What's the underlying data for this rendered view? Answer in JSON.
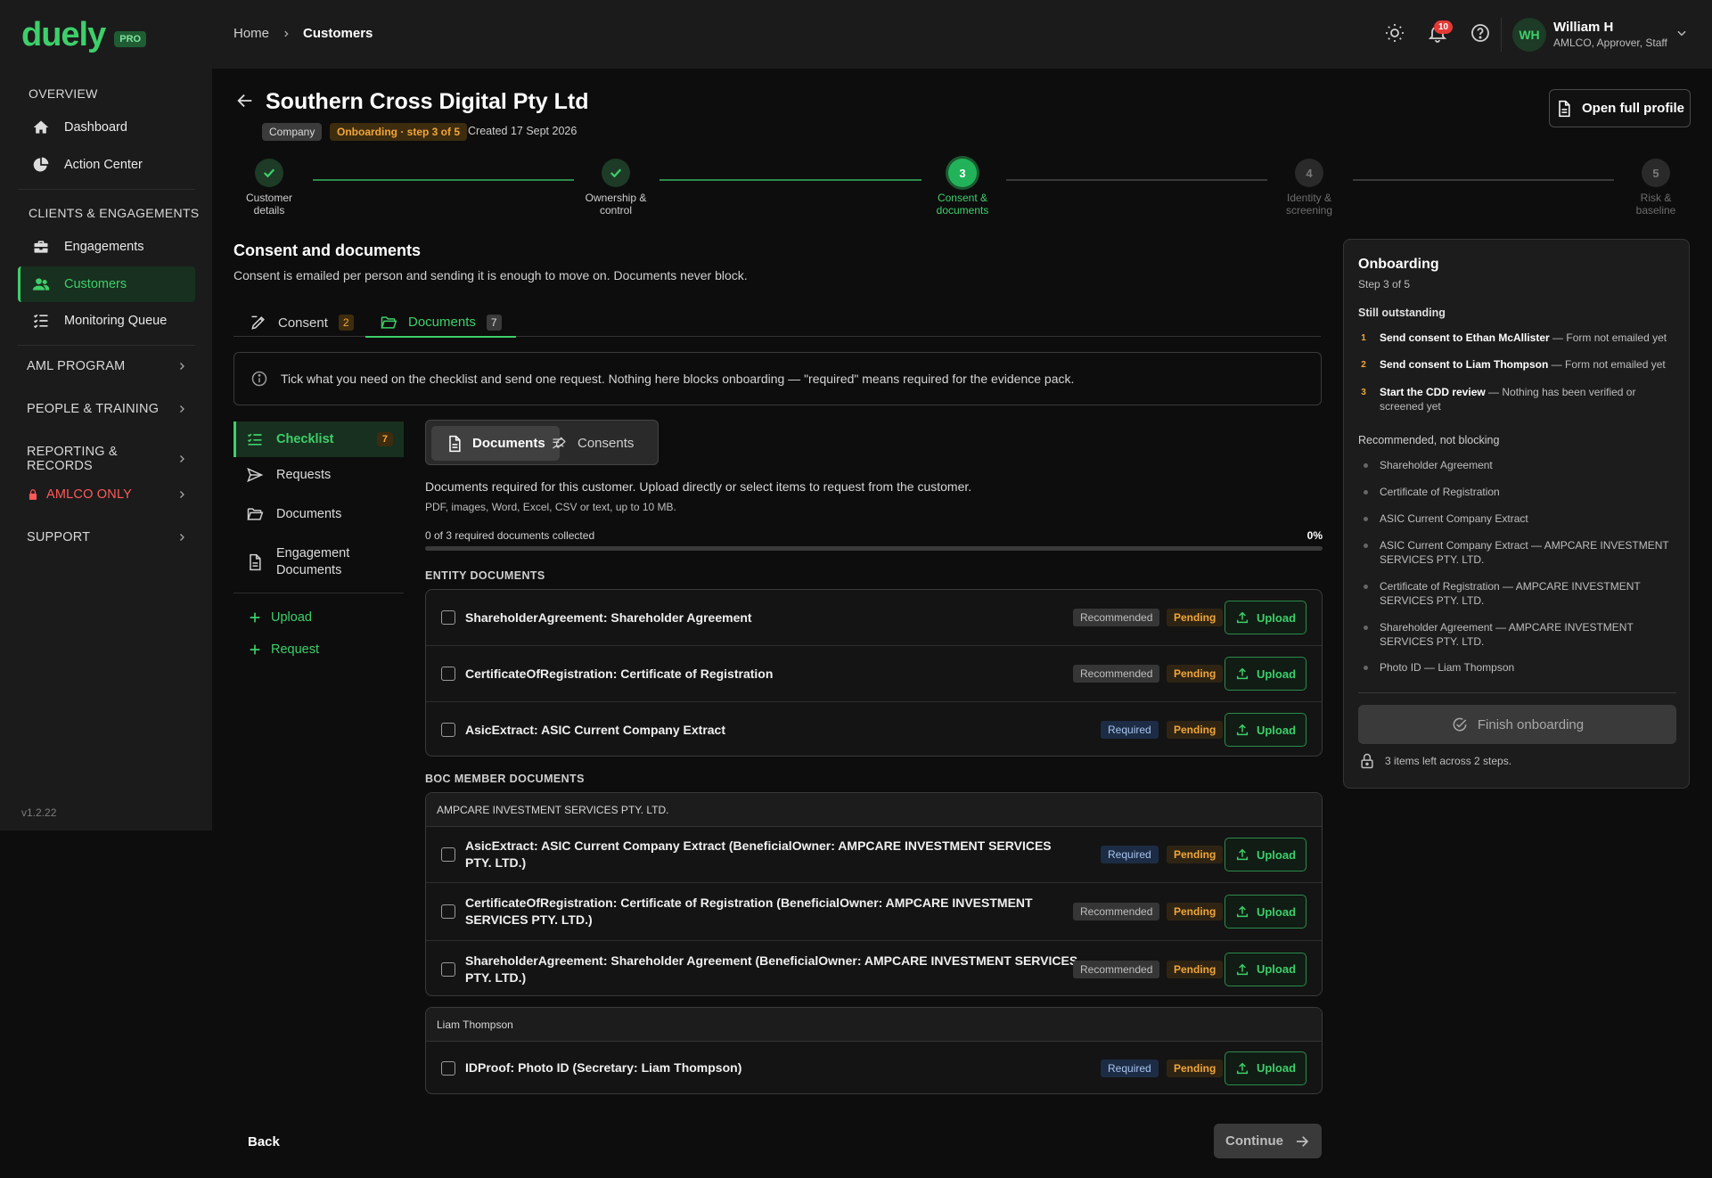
{
  "app": {
    "logo": "duely",
    "plan_badge": "PRO",
    "version": "v1.2.22"
  },
  "sidebar": {
    "overview_label": "OVERVIEW",
    "clients_label": "CLIENTS & ENGAGEMENTS",
    "items": [
      {
        "label": "Dashboard",
        "icon": "home-icon"
      },
      {
        "label": "Action Center",
        "icon": "pie-chart-icon"
      },
      {
        "label": "Engagements",
        "icon": "briefcase-icon"
      },
      {
        "label": "Customers",
        "icon": "users-icon"
      },
      {
        "label": "Monitoring Queue",
        "icon": "list-check-icon"
      }
    ],
    "groups": [
      "AML PROGRAM",
      "PEOPLE & TRAINING",
      "REPORTING & RECORDS",
      "AMLCO ONLY",
      "SUPPORT"
    ],
    "accent": "#3ecf6a",
    "restricted_color": "#ff5a5a"
  },
  "topbar": {
    "breadcrumb": {
      "home": "Home",
      "current": "Customers"
    },
    "notification_count": "10",
    "user": {
      "initials": "WH",
      "name": "William H",
      "roles": "AMLCO, Approver, Staff"
    }
  },
  "header": {
    "title": "Southern Cross Digital Pty Ltd",
    "type_tag": "Company",
    "status_tag": "Onboarding · step 3 of 5",
    "created": "Created 17 Sept 2026",
    "open_profile": "Open full profile"
  },
  "stepper": [
    {
      "number": "1",
      "label1": "Customer",
      "label2": "details",
      "state": "done"
    },
    {
      "number": "2",
      "label1": "Ownership &",
      "label2": "control",
      "state": "done"
    },
    {
      "number": "3",
      "label1": "Consent &",
      "label2": "documents",
      "state": "current"
    },
    {
      "number": "4",
      "label1": "Identity &",
      "label2": "screening",
      "state": "todo"
    },
    {
      "number": "5",
      "label1": "Risk &",
      "label2": "baseline",
      "state": "todo"
    }
  ],
  "section": {
    "title": "Consent and documents",
    "subtitle": "Consent is emailed per person and sending it is enough to move on. Documents never block.",
    "tabs": [
      {
        "label": "Consent",
        "count": "2"
      },
      {
        "label": "Documents",
        "count": "7"
      }
    ],
    "info": "Tick what you need on the checklist and send one request. Nothing here blocks onboarding — \"required\" means required for the evidence pack."
  },
  "subnav": {
    "items": [
      {
        "label": "Checklist",
        "count": "7"
      },
      {
        "label": "Requests"
      },
      {
        "label": "Documents"
      },
      {
        "label1": "Engagement",
        "label2": "Documents"
      }
    ],
    "actions": [
      "Upload",
      "Request"
    ]
  },
  "documents": {
    "segments": [
      "Documents",
      "Consents"
    ],
    "description": "Documents required for this customer. Upload directly or select items to request from the customer.",
    "formats": "PDF, images, Word, Excel, CSV or text, up to 10 MB.",
    "progress_label": "0 of 3 required documents collected",
    "progress_pct": "0%",
    "progress_value": 0,
    "upload_label": "Upload",
    "entity_group": "ENTITY DOCUMENTS",
    "entity_rows": [
      {
        "label": "ShareholderAgreement: Shareholder Agreement",
        "level": "Recommended",
        "status": "Pending"
      },
      {
        "label": "CertificateOfRegistration: Certificate of Registration",
        "level": "Recommended",
        "status": "Pending"
      },
      {
        "label": "AsicExtract: ASIC Current Company Extract",
        "level": "Required",
        "status": "Pending"
      }
    ],
    "boc_group": "BOC MEMBER DOCUMENTS",
    "boc_cards": [
      {
        "heading": "AMPCARE INVESTMENT SERVICES PTY. LTD.",
        "rows": [
          {
            "label": "AsicExtract: ASIC Current Company Extract (BeneficialOwner: AMPCARE INVESTMENT SERVICES PTY. LTD.)",
            "level": "Required",
            "status": "Pending"
          },
          {
            "label": "CertificateOfRegistration: Certificate of Registration (BeneficialOwner: AMPCARE INVESTMENT SERVICES PTY. LTD.)",
            "level": "Recommended",
            "status": "Pending"
          },
          {
            "label": "ShareholderAgreement: Shareholder Agreement (BeneficialOwner: AMPCARE INVESTMENT SERVICES PTY. LTD.)",
            "level": "Recommended",
            "status": "Pending"
          }
        ]
      },
      {
        "heading": "Liam Thompson",
        "rows": [
          {
            "label": "IDProof: Photo ID (Secretary: Liam Thompson)",
            "level": "Required",
            "status": "Pending"
          }
        ]
      }
    ]
  },
  "footer": {
    "back": "Back",
    "continue": "Continue"
  },
  "panel": {
    "title": "Onboarding",
    "step": "Step 3 of 5",
    "outstanding_label": "Still outstanding",
    "outstanding": [
      {
        "num": "1",
        "action": "Send consent to Ethan McAllister",
        "detail": " — Form not emailed yet"
      },
      {
        "num": "2",
        "action": "Send consent to Liam Thompson",
        "detail": " — Form not emailed yet"
      },
      {
        "num": "3",
        "action": "Start the CDD review",
        "detail": " — Nothing has been verified or screened yet"
      }
    ],
    "recommended_label": "Recommended, not blocking",
    "recommended": [
      "Shareholder Agreement",
      "Certificate of Registration",
      "ASIC Current Company Extract",
      "ASIC Current Company Extract — AMPCARE INVESTMENT SERVICES PTY. LTD.",
      "Certificate of Registration — AMPCARE INVESTMENT SERVICES PTY. LTD.",
      "Shareholder Agreement — AMPCARE INVESTMENT SERVICES PTY. LTD.",
      "Photo ID — Liam Thompson"
    ],
    "finish": "Finish onboarding",
    "remaining": "3 items left across 2 steps."
  }
}
